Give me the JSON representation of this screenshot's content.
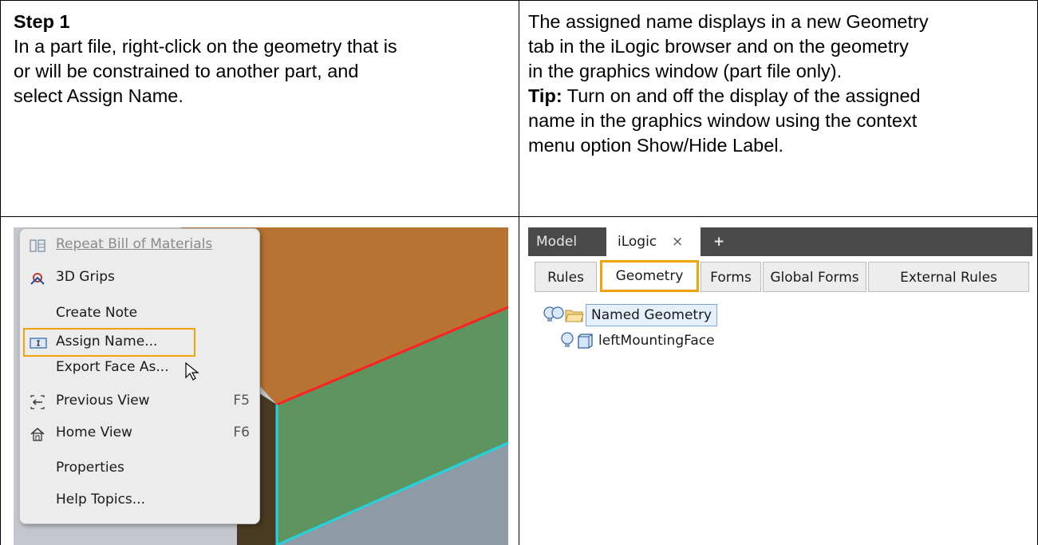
{
  "step": {
    "title": "Step 1",
    "left_text_lines": [
      "In a part file, right-click on the geometry that is",
      "or will be constrained to another part, and",
      "select Assign Name."
    ],
    "right_text_lines": [
      "The assigned name displays in a new Geometry",
      "tab in the iLogic browser and on the geometry",
      "in the graphics window (part file only)."
    ],
    "tip_label": "Tip:",
    "tip_text_lines": [
      " Turn on and off the display of the assigned",
      "name in the graphics window using the context",
      "menu option Show/Hide Label."
    ]
  },
  "context_menu": {
    "items": [
      {
        "label": "Repeat Bill of Materials",
        "icon": "bom-icon",
        "disabled": true,
        "shortcut": ""
      },
      {
        "label": "3D Grips",
        "icon": "grips-icon",
        "disabled": false,
        "shortcut": ""
      },
      {
        "label": "Create Note",
        "icon": "",
        "disabled": false,
        "shortcut": ""
      },
      {
        "label": "Assign Name...",
        "icon": "name-tag-icon",
        "disabled": false,
        "shortcut": ""
      },
      {
        "label": "Export Face As...",
        "icon": "",
        "disabled": false,
        "shortcut": ""
      },
      {
        "label": "Previous View",
        "icon": "previous-view-icon",
        "disabled": false,
        "shortcut": "F5"
      },
      {
        "label": "Home View",
        "icon": "home-view-icon",
        "disabled": false,
        "shortcut": "F6"
      },
      {
        "label": "Properties",
        "icon": "",
        "disabled": false,
        "shortcut": ""
      },
      {
        "label": "Help Topics...",
        "icon": "",
        "disabled": false,
        "shortcut": ""
      }
    ]
  },
  "ilogic_browser": {
    "top_tabs": [
      "Model",
      "iLogic",
      "×",
      "+"
    ],
    "sub_tabs": [
      "Rules",
      "Geometry",
      "Forms",
      "Global Forms",
      "External Rules"
    ],
    "active_sub_tab": "Geometry",
    "tree": {
      "root_label": "Named Geometry",
      "child_label": "leftMountingFace"
    }
  },
  "colors": {
    "highlight": "#f0a30a",
    "face_top": "#b87333",
    "face_front": "#5e9460",
    "face_dark": "#4a3a22",
    "edge_red": "#ff2020",
    "edge_cyan": "#22d3dd"
  }
}
